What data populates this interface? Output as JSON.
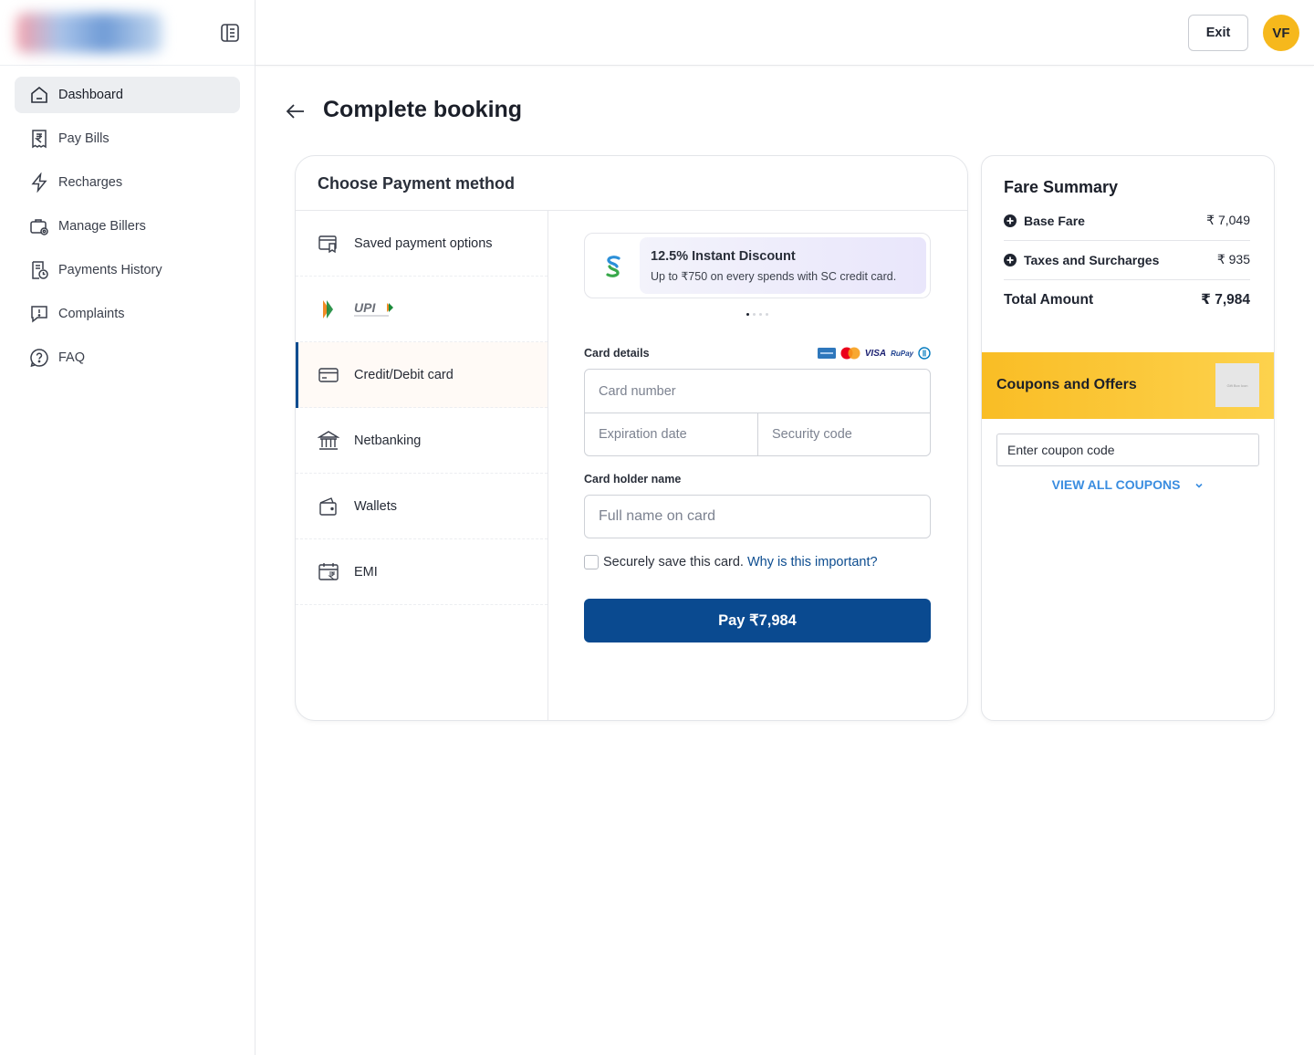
{
  "sidebar": {
    "items": [
      {
        "label": "Dashboard",
        "icon": "home-icon",
        "active": true
      },
      {
        "label": "Pay Bills",
        "icon": "bill-icon"
      },
      {
        "label": "Recharges",
        "icon": "lightning-icon"
      },
      {
        "label": "Manage Billers",
        "icon": "briefcase-gear-icon"
      },
      {
        "label": "Payments History",
        "icon": "history-document-icon"
      },
      {
        "label": "Complaints",
        "icon": "complaint-icon"
      },
      {
        "label": "FAQ",
        "icon": "question-icon"
      }
    ]
  },
  "header": {
    "exit_label": "Exit",
    "avatar_initials": "VF"
  },
  "page": {
    "title": "Complete booking"
  },
  "payment": {
    "heading": "Choose Payment method",
    "methods": [
      {
        "label": "Saved payment options",
        "icon": "saved-card-icon"
      },
      {
        "label": "",
        "icon": "upi-logo-icon"
      },
      {
        "label": "Credit/Debit card",
        "icon": "card-icon",
        "active": true
      },
      {
        "label": "Netbanking",
        "icon": "bank-icon"
      },
      {
        "label": "Wallets",
        "icon": "wallet-icon"
      },
      {
        "label": "EMI",
        "icon": "emi-calendar-icon"
      }
    ],
    "offer": {
      "title": "12.5% Instant Discount",
      "subtitle": "Up to ₹750 on every spends with SC credit card."
    },
    "card_details_label": "Card details",
    "card_number_placeholder": "Card number",
    "expiration_placeholder": "Expiration date",
    "security_placeholder": "Security code",
    "holder_label": "Card holder name",
    "holder_placeholder": "Full name on card",
    "save_text": "Securely save this card.",
    "why_link": "Why is this important?",
    "pay_label": "Pay ₹7,984",
    "brand_visa": "VISA",
    "brand_rupay": "RuPay"
  },
  "fare": {
    "title": "Fare Summary",
    "rows": [
      {
        "label": "Base Fare",
        "value": "₹ 7,049"
      },
      {
        "label": "Taxes and Surcharges",
        "value": "₹ 935"
      }
    ],
    "total_label": "Total Amount",
    "total_value": "₹ 7,984"
  },
  "coupons": {
    "title": "Coupons and Offers",
    "gift_alt": "Gift Box Icon",
    "input_placeholder": "Enter coupon code",
    "view_all": "VIEW ALL COUPONS"
  },
  "colors": {
    "primary": "#0a4a90",
    "accent": "#f6b81c",
    "link": "#3a8de0"
  }
}
